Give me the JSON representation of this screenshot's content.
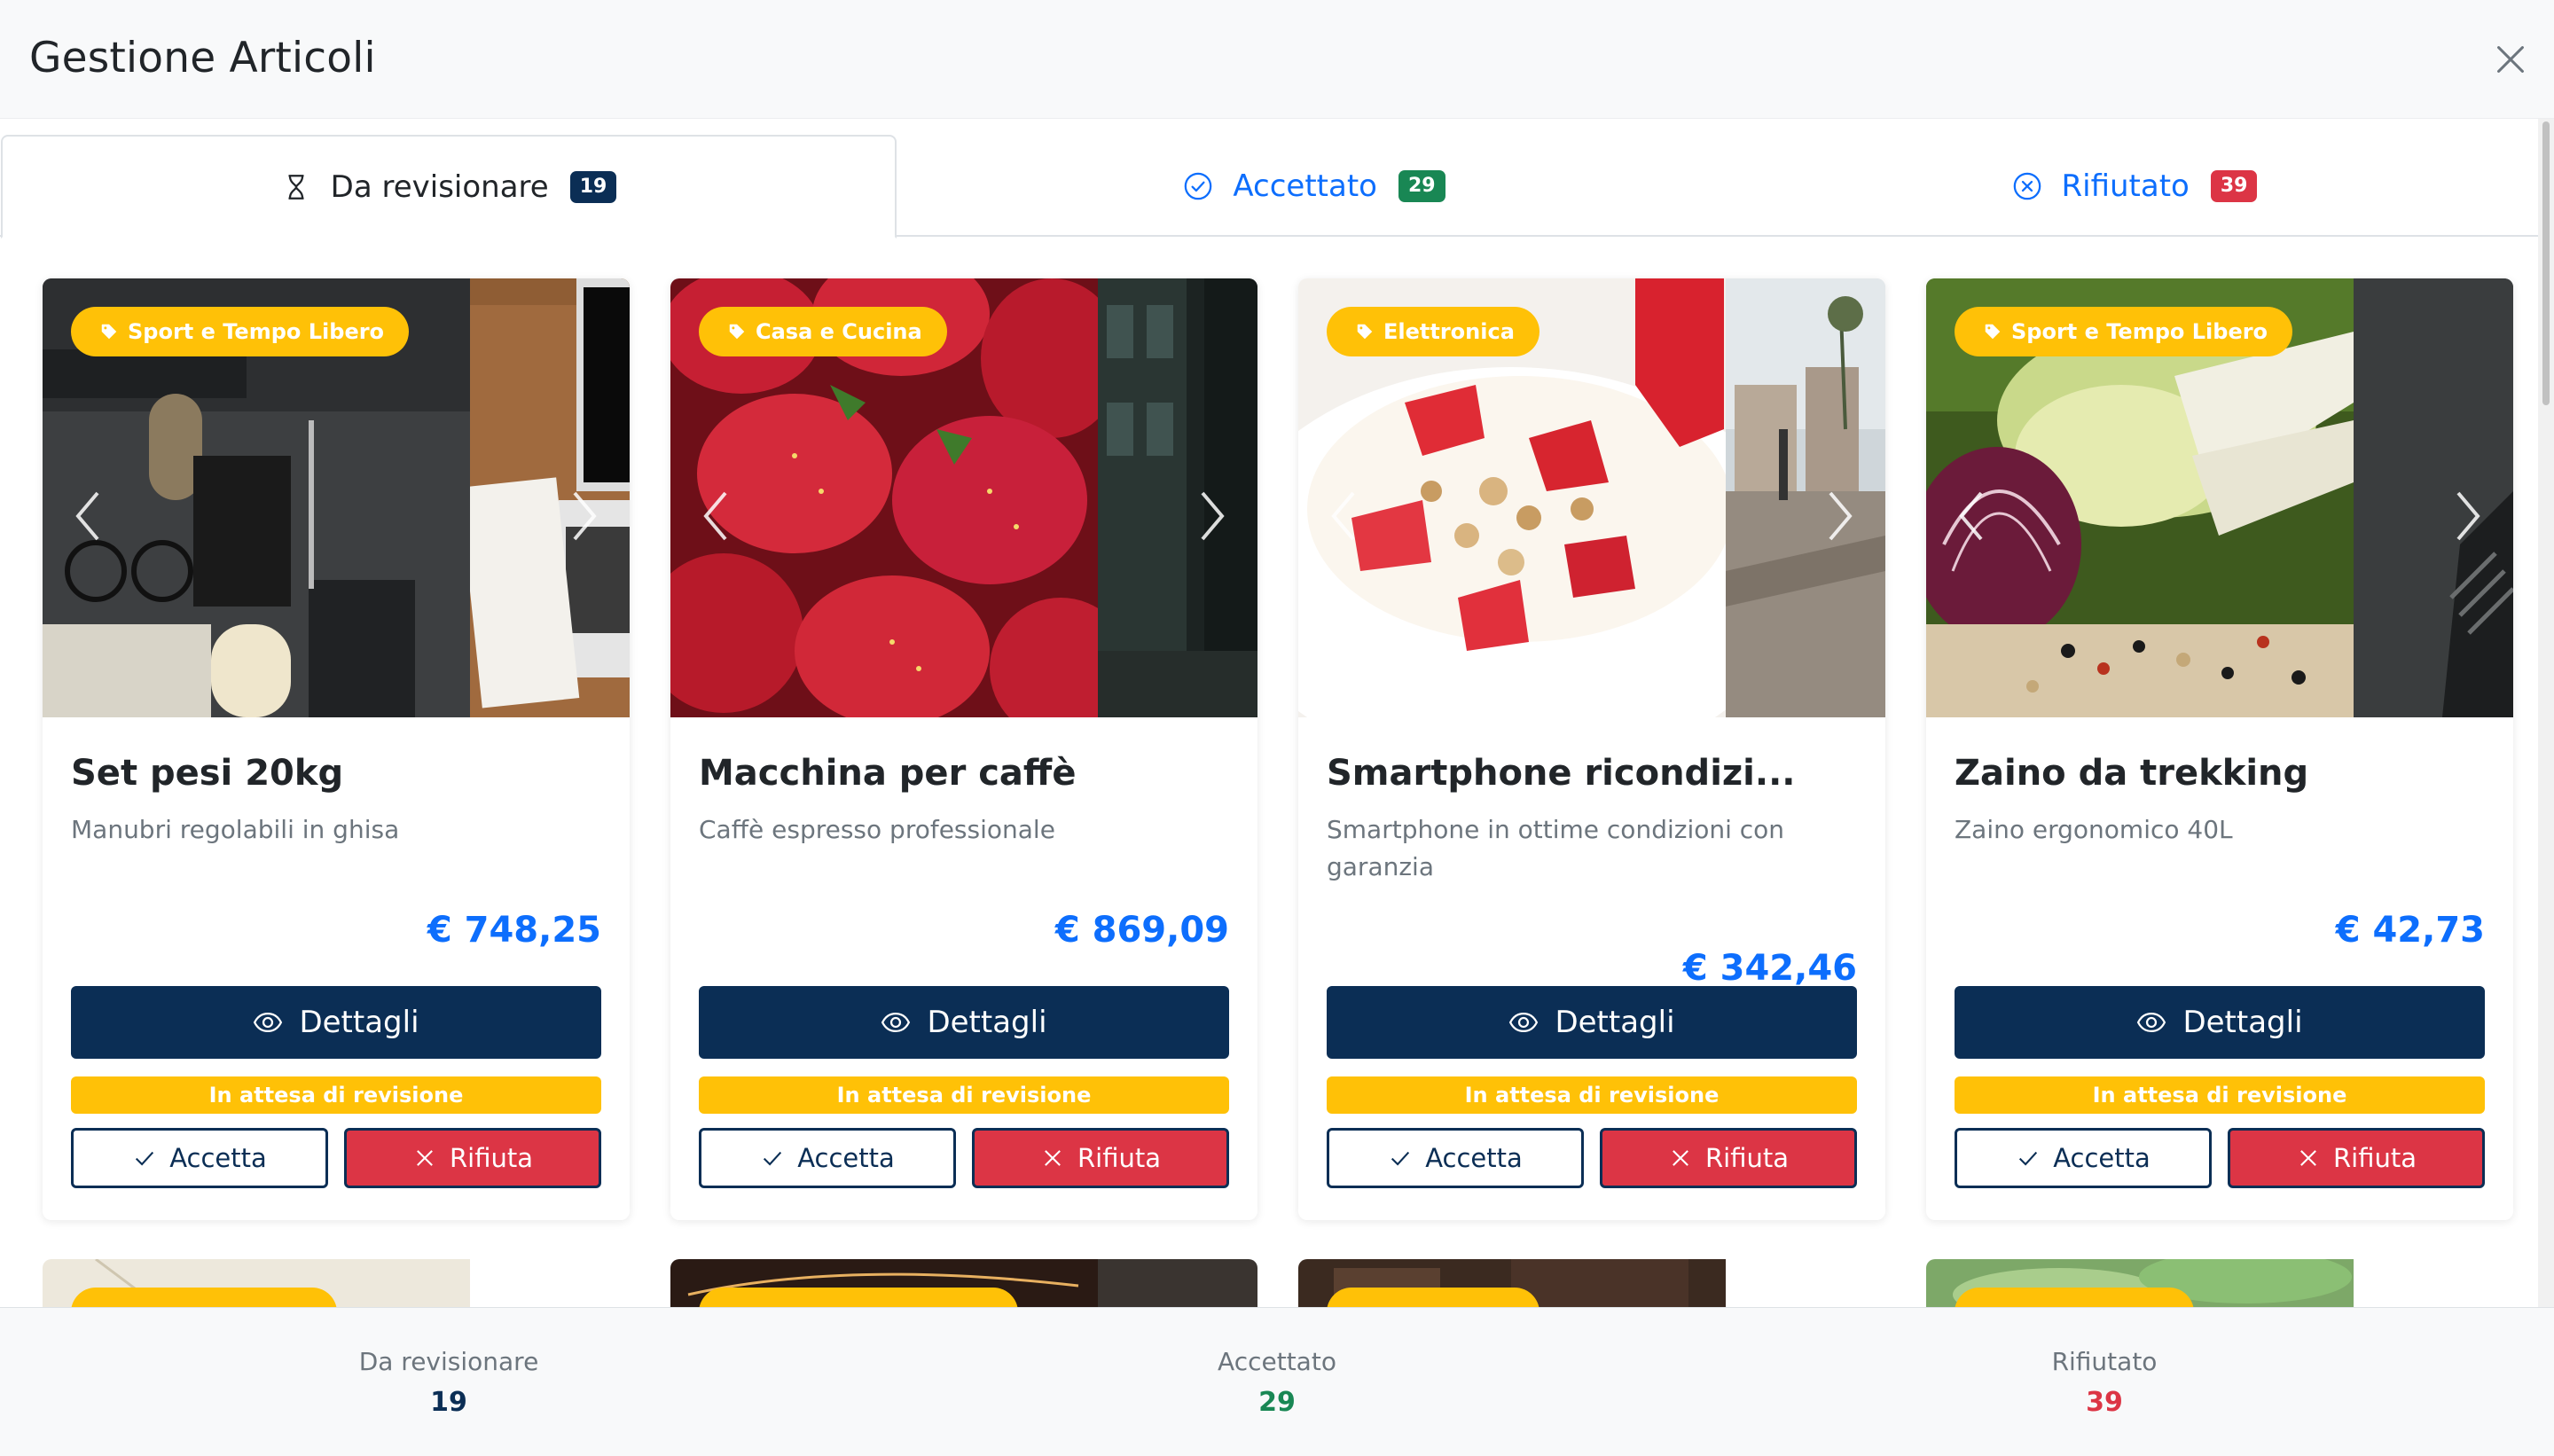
{
  "header": {
    "title": "Gestione Articoli"
  },
  "tabs": [
    {
      "label": "Da revisionare",
      "count": "19",
      "icon": "hourglass-icon",
      "active": true
    },
    {
      "label": "Accettato",
      "count": "29",
      "icon": "check-circle-icon"
    },
    {
      "label": "Rifiutato",
      "count": "39",
      "icon": "x-circle-icon"
    }
  ],
  "cards": [
    {
      "category": "Sport e Tempo Libero",
      "title": "Set pesi 20kg",
      "description": "Manubri regolabili in ghisa",
      "price": "€ 748,25",
      "details_label": "Dettagli",
      "status": "In attesa di revisione",
      "accept_label": "Accetta",
      "reject_label": "Rifiuta"
    },
    {
      "category": "Casa e Cucina",
      "title": "Macchina per caffè",
      "description": "Caffè espresso professionale",
      "price": "€ 869,09",
      "details_label": "Dettagli",
      "status": "In attesa di revisione",
      "accept_label": "Accetta",
      "reject_label": "Rifiuta"
    },
    {
      "category": "Elettronica",
      "title": "Smartphone ricondizi...",
      "description": "Smartphone in ottime condizioni con garanzia",
      "price": "€ 342,46",
      "details_label": "Dettagli",
      "status": "In attesa di revisione",
      "accept_label": "Accetta",
      "reject_label": "Rifiuta"
    },
    {
      "category": "Sport e Tempo Libero",
      "title": "Zaino da trekking",
      "description": "Zaino ergonomico 40L",
      "price": "€ 42,73",
      "details_label": "Dettagli",
      "status": "In attesa di revisione",
      "accept_label": "Accetta",
      "reject_label": "Rifiuta"
    }
  ],
  "footer": {
    "stats": [
      {
        "label": "Da revisionare",
        "value": "19"
      },
      {
        "label": "Accettato",
        "value": "29"
      },
      {
        "label": "Rifiutato",
        "value": "39"
      }
    ]
  },
  "colors": {
    "primary": "#0b2e55",
    "accent": "#0d6efd",
    "warning": "#ffc107",
    "danger": "#dc3545",
    "success": "#198754"
  }
}
